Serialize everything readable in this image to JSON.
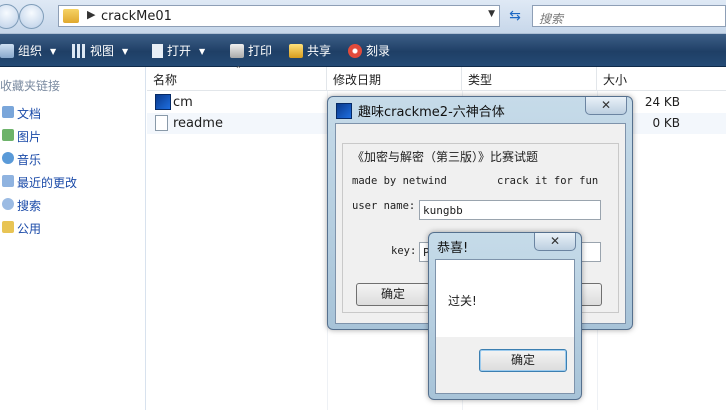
{
  "explorer": {
    "path": "crackMe01",
    "search_placeholder": "搜索",
    "toolbar": {
      "organize": "组织",
      "views": "视图",
      "open": "打开",
      "print": "打印",
      "share": "共享",
      "burn": "刻录"
    },
    "favorites_header": "收藏夹链接",
    "nav": [
      "文档",
      "图片",
      "音乐",
      "最近的更改",
      "搜索",
      "公用"
    ],
    "columns": {
      "name": "名称",
      "date": "修改日期",
      "type": "类型",
      "size": "大小"
    },
    "files": [
      {
        "name": "cm",
        "size": "24 KB"
      },
      {
        "name": "readme",
        "size": "0 KB"
      }
    ]
  },
  "crackme": {
    "title": "趣味crackme2-六神合体",
    "close": "✕",
    "heading": "《加密与解密（第三版）》比赛试题",
    "made_by": "made by netwind",
    "crack_it": "crack it for fun",
    "user_label": "user name:",
    "user_value": "kungbb",
    "key_label": "key:",
    "key_value": "P",
    "ok_label": "确定"
  },
  "msgbox": {
    "title": "恭喜!",
    "close": "✕",
    "message": "过关!",
    "ok_label": "确定"
  },
  "colors": {
    "cmdbar": "#244a75",
    "link": "#1a4aa8",
    "dialog_frame": "#a7c3d8"
  }
}
